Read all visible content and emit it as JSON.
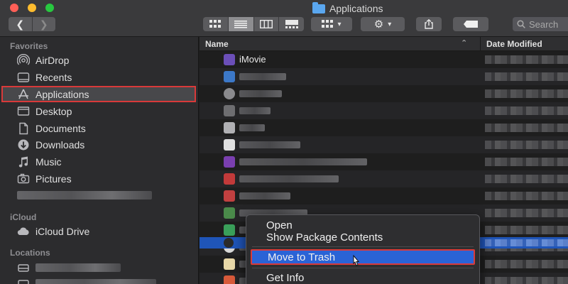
{
  "window": {
    "title": "Applications"
  },
  "toolbar": {
    "back_glyph": "❮",
    "forward_glyph": "❯",
    "search_placeholder": "Search",
    "views": [
      {
        "icon": "icon-view-icon",
        "active": false
      },
      {
        "icon": "list-view-icon",
        "active": true
      },
      {
        "icon": "column-view-icon",
        "active": false
      },
      {
        "icon": "gallery-view-icon",
        "active": false
      }
    ]
  },
  "sidebar": {
    "favorites_header": "Favorites",
    "favorites": [
      {
        "label": "AirDrop",
        "icon": "airdrop-icon"
      },
      {
        "label": "Recents",
        "icon": "recents-icon"
      },
      {
        "label": "Applications",
        "icon": "applications-icon",
        "selected": true
      },
      {
        "label": "Desktop",
        "icon": "desktop-icon"
      },
      {
        "label": "Documents",
        "icon": "documents-icon"
      },
      {
        "label": "Downloads",
        "icon": "downloads-icon"
      },
      {
        "label": "Music",
        "icon": "music-icon"
      },
      {
        "label": "Pictures",
        "icon": "pictures-icon"
      }
    ],
    "icloud_header": "iCloud",
    "icloud": [
      {
        "label": "iCloud Drive",
        "icon": "cloud-icon"
      }
    ],
    "locations_header": "Locations"
  },
  "filelist": {
    "columns": {
      "name": "Name",
      "date": "Date Modified"
    },
    "first_row_label": "iMovie"
  },
  "context_menu": {
    "items": [
      {
        "label": "Open"
      },
      {
        "label": "Show Package Contents"
      },
      {
        "label": "Move to Trash",
        "hovered": true
      },
      {
        "label": "Get Info"
      }
    ]
  },
  "colors": {
    "accent_blue": "#2a63d6",
    "selection_outline_red": "#d93a3a",
    "sidebar_bg": "#2c2c2e"
  }
}
